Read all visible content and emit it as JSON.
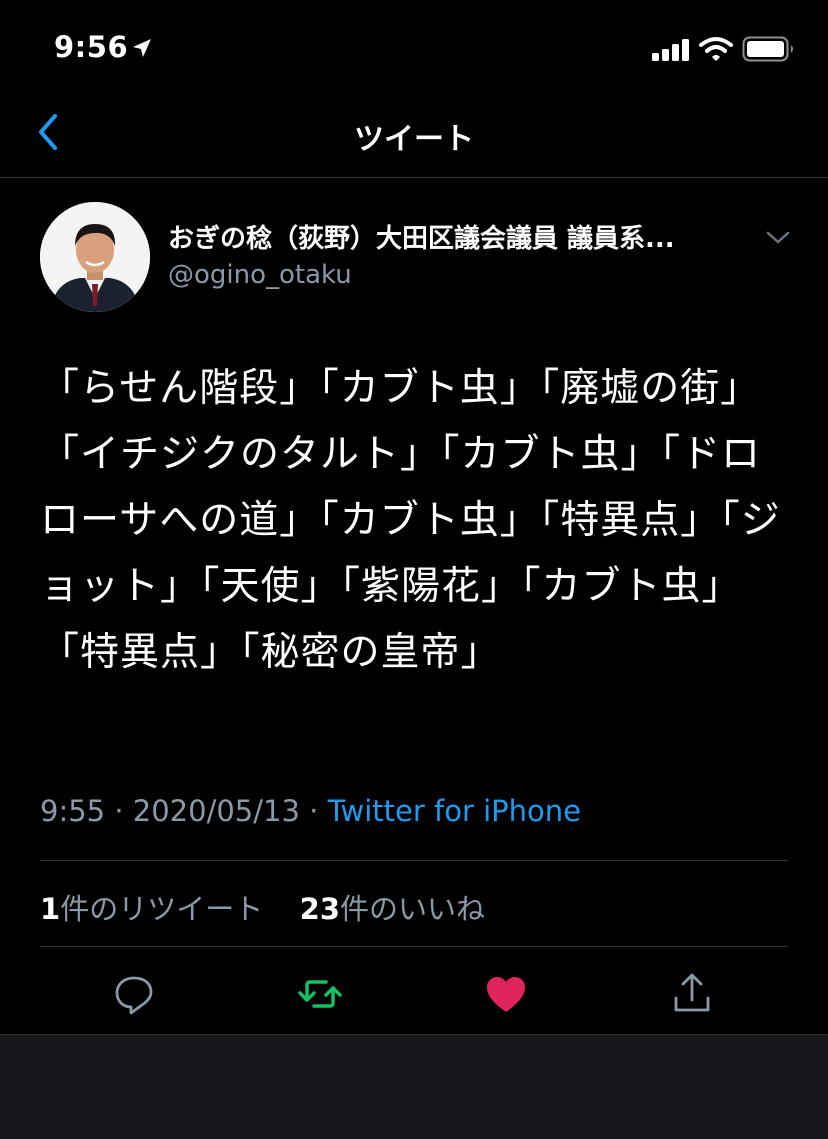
{
  "status_bar": {
    "time": "9:56"
  },
  "nav": {
    "title": "ツイート"
  },
  "author": {
    "name": "おぎの稔（荻野）大田区議会議員 議員系...",
    "handle": "@ogino_otaku"
  },
  "tweet": {
    "text": "「らせん階段」「カブト虫」「廃墟の街」「イチジクのタルト」「カブト虫」「ドロローサへの道」「カブト虫」「特異点」「ジョット」「天使」「紫陽花」「カブト虫」「特異点」「秘密の皇帝」",
    "time": "9:55",
    "separator": "·",
    "date": "2020/05/13",
    "source": "Twitter for iPhone"
  },
  "stats": {
    "retweet_count": "1",
    "retweet_label": "件のリツイート",
    "like_count": "23",
    "like_label": "件のいいね"
  },
  "colors": {
    "accent": "#1d9bf0",
    "retweet": "#17bf63",
    "like": "#e0245e",
    "muted": "#8b98a5"
  },
  "icons": [
    "location-arrow-icon",
    "signal-icon",
    "wifi-icon",
    "battery-icon",
    "chevron-left-icon",
    "chevron-down-icon",
    "reply-icon",
    "retweet-icon",
    "heart-icon",
    "share-icon"
  ]
}
